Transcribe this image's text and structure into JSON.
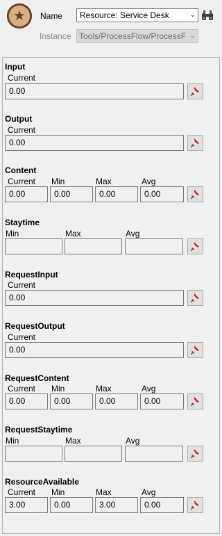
{
  "header": {
    "name_label": "Name",
    "name_value": "Resource: Service Desk",
    "instance_label": "Instance",
    "instance_value": "Tools/ProcessFlow/ProcessF"
  },
  "sections": {
    "input": {
      "title": "Input",
      "current_label": "Current",
      "current": "0.00"
    },
    "output": {
      "title": "Output",
      "current_label": "Current",
      "current": "0.00"
    },
    "content": {
      "title": "Content",
      "current_label": "Current",
      "min_label": "Min",
      "max_label": "Max",
      "avg_label": "Avg",
      "current": "0.00",
      "min": "0.00",
      "max": "0.00",
      "avg": "0.00"
    },
    "staytime": {
      "title": "Staytime",
      "min_label": "Min",
      "max_label": "Max",
      "avg_label": "Avg",
      "min": "",
      "max": "",
      "avg": ""
    },
    "request_input": {
      "title": "RequestInput",
      "current_label": "Current",
      "current": "0.00"
    },
    "request_output": {
      "title": "RequestOutput",
      "current_label": "Current",
      "current": "0.00"
    },
    "request_content": {
      "title": "RequestContent",
      "current_label": "Current",
      "min_label": "Min",
      "max_label": "Max",
      "avg_label": "Avg",
      "current": "0.00",
      "min": "0.00",
      "max": "0.00",
      "avg": "0.00"
    },
    "request_staytime": {
      "title": "RequestStaytime",
      "min_label": "Min",
      "max_label": "Max",
      "avg_label": "Avg",
      "min": "",
      "max": "",
      "avg": ""
    },
    "resource_available": {
      "title": "ResourceAvailable",
      "current_label": "Current",
      "min_label": "Min",
      "max_label": "Max",
      "avg_label": "Avg",
      "current": "3.00",
      "min": "0.00",
      "max": "3.00",
      "avg": "0.00"
    }
  },
  "icons": {
    "app": "star-badge-icon",
    "find": "binoculars-icon",
    "pin": "pushpin-icon"
  },
  "colors": {
    "pin_red": "#c62828",
    "badge_brown": "#7a4f1e"
  }
}
